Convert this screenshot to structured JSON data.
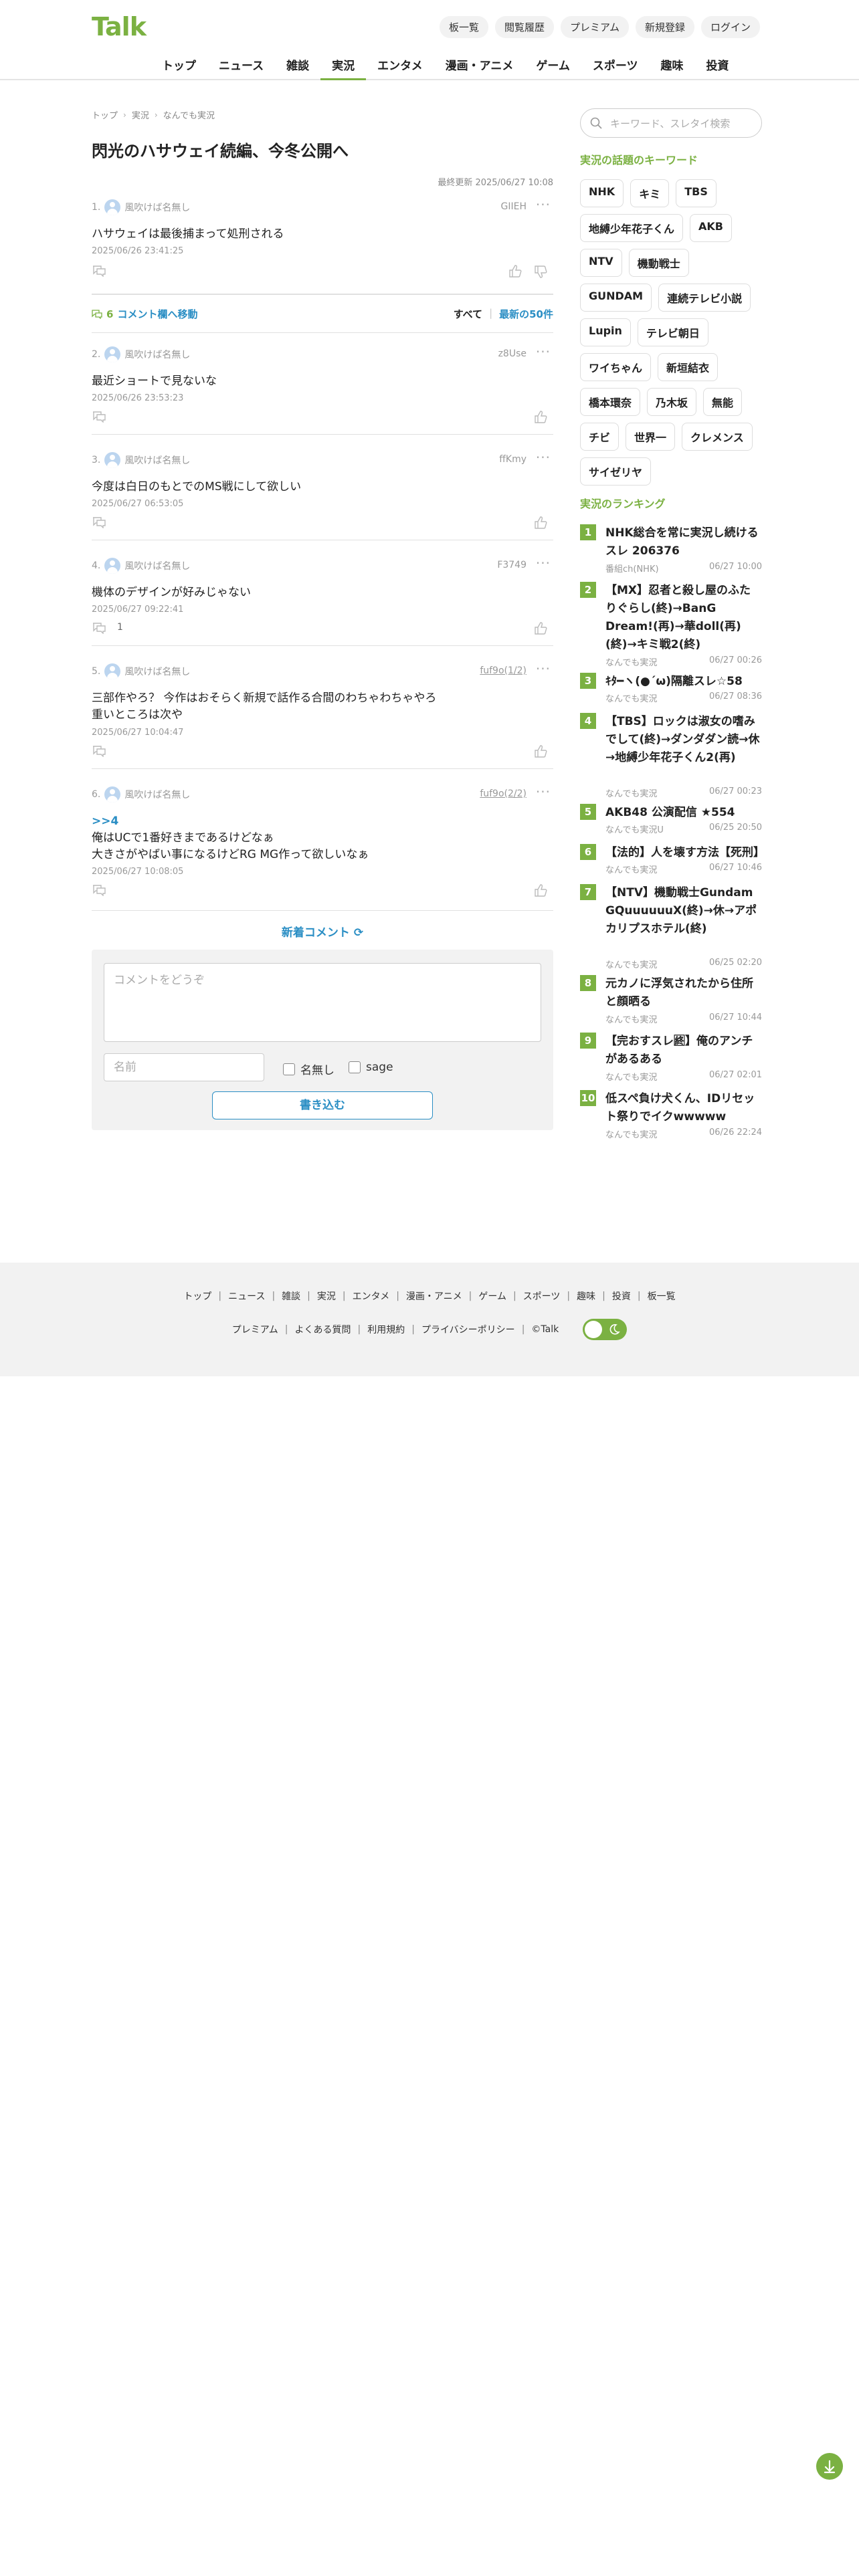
{
  "header": {
    "logo": "Talk",
    "top_links": [
      "板一覧",
      "閲覧履歴",
      "プレミアム",
      "新規登録",
      "ログイン"
    ],
    "nav": [
      "トップ",
      "ニュース",
      "雑談",
      "実況",
      "エンタメ",
      "漫画・アニメ",
      "ゲーム",
      "スポーツ",
      "趣味",
      "投資"
    ],
    "nav_active": "実況"
  },
  "breadcrumb": [
    "トップ",
    "実況",
    "なんでも実況"
  ],
  "page_title": "閃光のハサウェイ続編、今冬公開へ",
  "updated": "最終更新 2025/06/27 10:08",
  "comments": [
    {
      "num": "1.",
      "name": "風吹けば名無し",
      "id": "GIIEH",
      "body": [
        "ハサウェイは最後捕まって処刑される"
      ],
      "date": "2025/06/26 23:41:25",
      "replies": ""
    },
    {
      "num": "2.",
      "name": "風吹けば名無し",
      "id": "z8Use",
      "body": [
        "最近ショートで見ないな"
      ],
      "date": "2025/06/26 23:53:23",
      "replies": ""
    },
    {
      "num": "3.",
      "name": "風吹けば名無し",
      "id": "ffKmy",
      "body": [
        "今度は白日のもとでのMS戦にして欲しい"
      ],
      "date": "2025/06/27 06:53:05",
      "replies": ""
    },
    {
      "num": "4.",
      "name": "風吹けば名無し",
      "id": "F3749",
      "body": [
        "機体のデザインが好みじゃない"
      ],
      "date": "2025/06/27 09:22:41",
      "replies": "1"
    },
    {
      "num": "5.",
      "name": "風吹けば名無し",
      "id": "fuf9o(1/2)",
      "body": [
        "三部作やろ？ 今作はおそらく新規で話作る合間のわちゃわちゃやろ",
        "重いところは次や"
      ],
      "date": "2025/06/27 10:04:47",
      "replies": ""
    },
    {
      "num": "6.",
      "name": "風吹けば名無し",
      "id": "fuf9o(2/2)",
      "anchor": ">>4",
      "body": [
        "俺はUCで1番好きまであるけどなぁ",
        "大きさがやばい事になるけどRG MG作って欲しいなぁ"
      ],
      "date": "2025/06/27 10:08:05",
      "replies": ""
    }
  ],
  "comment_bar": {
    "count": "6",
    "jump_label": "コメント欄へ移動",
    "all_label": "すべて",
    "latest_label": "最新の50件"
  },
  "new_comments_label": "新着コメント",
  "form": {
    "textarea_placeholder": "コメントをどうぞ",
    "name_placeholder": "名前",
    "anon_label": "名無し",
    "sage_label": "sage",
    "submit_label": "書き込む"
  },
  "sidebar": {
    "search_placeholder": "キーワード、スレタイ検索",
    "keywords_title": "実況の話題のキーワード",
    "keywords": [
      "NHK",
      "キミ",
      "TBS",
      "地縛少年花子くん",
      "AKB",
      "NTV",
      "機動戦士",
      "GUNDAM",
      "連続テレビ小説",
      "Lupin",
      "テレビ朝日",
      "ワイちゃん",
      "新垣結衣",
      "橋本環奈",
      "乃木坂",
      "無能",
      "チビ",
      "世界一",
      "クレメンス",
      "サイゼリヤ"
    ],
    "ranking_title": "実況のランキング",
    "ranking": [
      {
        "num": "1",
        "title": "NHK総合を常に実況し続けるスレ 206376",
        "board": "番組ch(NHK)",
        "time": "06/27 10:00"
      },
      {
        "num": "2",
        "title": "【MX】忍者と殺し屋のふたりぐらし(終)→BanG Dream!(再)→華doll(再)(終)→キミ戦2(終)",
        "board": "なんでも実況",
        "time": "06/27 00:26"
      },
      {
        "num": "3",
        "title": "ｷﾀ━ヽ(●´ω)隔離スレ☆58",
        "board": "なんでも実況",
        "time": "06/27 08:36"
      },
      {
        "num": "4",
        "title": "【TBS】ロックは淑女の嗜みでして(終)→ダンダダン読→休→地縛少年花子くん2(再)",
        "board": "なんでも実況",
        "time": "06/27 00:23"
      },
      {
        "num": "5",
        "title": "AKB48 公演配信 ★554",
        "board": "なんでも実況U",
        "time": "06/25 20:50"
      },
      {
        "num": "6",
        "title": "【法的】人を壊す方法【死刑】",
        "board": "なんでも実況",
        "time": "06/27 10:46"
      },
      {
        "num": "7",
        "title": "【NTV】機動戦士Gundam GQuuuuuuX(終)→休→アポカリプスホテル(終)",
        "board": "なんでも実況",
        "time": "06/25 02:20"
      },
      {
        "num": "8",
        "title": "元カノに浮気されたから住所と顔晒る",
        "board": "なんでも実況",
        "time": "06/27 10:44"
      },
      {
        "num": "9",
        "title": "【完おすスレ🈡】俺のアンチがあるある",
        "board": "なんでも実況",
        "time": "06/27 02:01"
      },
      {
        "num": "10",
        "title": "低スペ負け犬くん、IDリセット祭りでイクwwwww",
        "board": "なんでも実況",
        "time": "06/26 22:24"
      }
    ]
  },
  "footer": {
    "row1": [
      "トップ",
      "ニュース",
      "雑談",
      "実況",
      "エンタメ",
      "漫画・アニメ",
      "ゲーム",
      "スポーツ",
      "趣味",
      "投資",
      "板一覧"
    ],
    "row2": [
      "プレミアム",
      "よくある質問",
      "利用規約",
      "プライバシーポリシー",
      "©Talk"
    ]
  },
  "colors": {
    "brand": "#7bb142",
    "link": "#2a8ec4"
  }
}
